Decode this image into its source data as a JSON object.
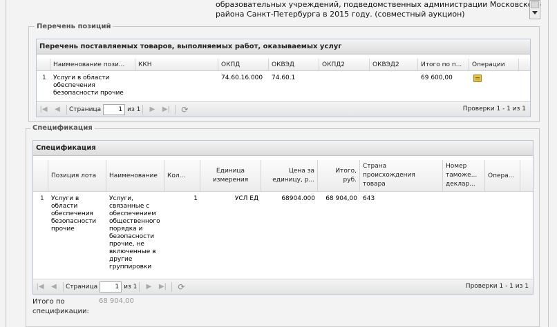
{
  "header_text": {
    "line1": "образовательных учреждений, подведомственных администрации Московского",
    "line2": "района Санкт-Петербурга в 2015 году. (совместный аукцион)"
  },
  "positions_fieldset": {
    "legend": "Перечень позиций",
    "panel_title": "Перечень поставляемых товаров, выполняемых работ, оказываемых услуг",
    "columns": [
      "Наименование пози...",
      "ККН",
      "ОКПД",
      "ОКВЭД",
      "ОКПД2",
      "ОКВЭД2",
      "Итого по п...",
      "Операции"
    ],
    "rows": [
      {
        "num": "1",
        "name": "Услуги в области обеспечения безопасности прочие",
        "kkn": "",
        "okpd": "74.60.16.000",
        "okved": "74.60.1",
        "okpd2": "",
        "okved2": "",
        "total": "69 600,00",
        "ops_icon": "document-icon"
      }
    ],
    "pager": {
      "page_label": "Страница",
      "page_value": "1",
      "of_label": "из 1",
      "info": "Проверки 1 - 1 из 1"
    }
  },
  "spec_fieldset": {
    "legend": "Спецификация",
    "panel_title": "Спецификация",
    "columns": [
      "Позиция лота",
      "Наименование",
      "Кол...",
      "Единица измерения",
      "Цена за единицу, р...",
      "Итого, руб.",
      "Страна происхождения товара",
      "Номер таможе... деклар...",
      "Опера..."
    ],
    "rows": [
      {
        "num": "1",
        "lot_position": "Услуги в области обеспечения безопасности прочие",
        "name": "Услуги, связанные с обеспечением общественного порядка и безопасности прочие, не включенные в другие группировки",
        "qty": "1",
        "unit": "УСЛ ЕД",
        "price": "68904.000",
        "total": "68 904,00",
        "country": "643",
        "customs": ""
      }
    ],
    "pager": {
      "page_label": "Страница",
      "page_value": "1",
      "of_label": "из 1",
      "info": "Проверки 1 - 1 из 1"
    }
  },
  "spec_total": {
    "label": "Итого по спецификации:",
    "value": "68 904,00"
  }
}
